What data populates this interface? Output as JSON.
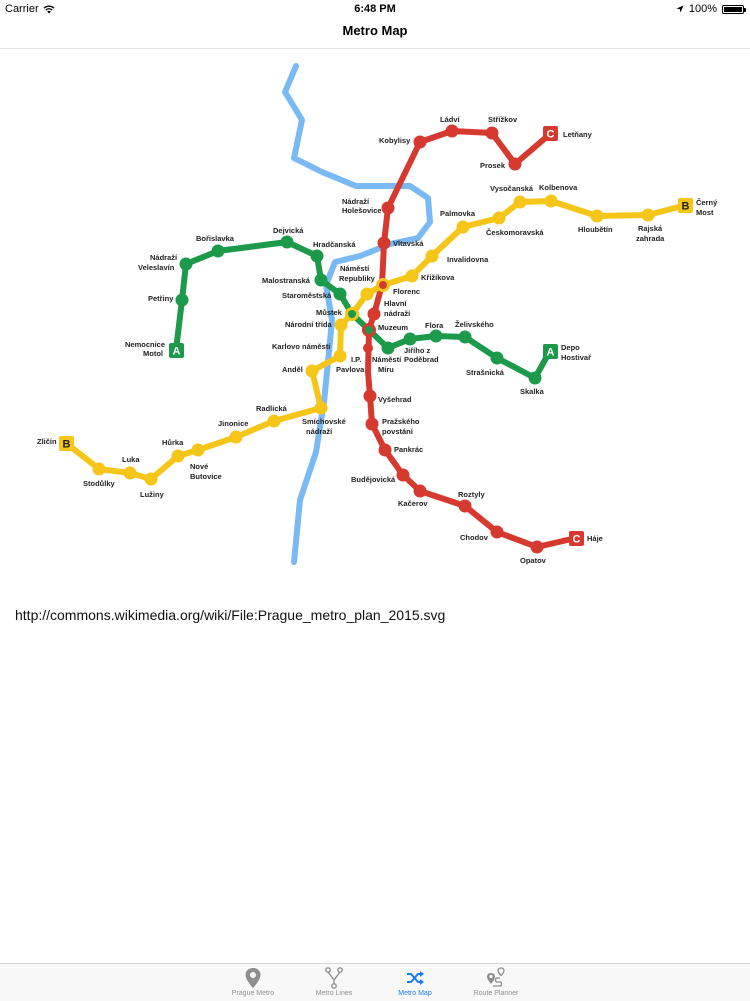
{
  "status_bar": {
    "carrier": "Carrier",
    "time": "6:48 PM",
    "battery": "100%",
    "battery_level": 1.0
  },
  "nav": {
    "title": "Metro Map"
  },
  "source_link": "http://commons.wikimedia.org/wiki/File:Prague_metro_plan_2015.svg",
  "colors": {
    "line_a": "#1c9a4a",
    "line_b": "#f5c518",
    "line_c": "#d63a2f",
    "river": "#79b9f4",
    "tab_active": "#1b7cf2",
    "tab_inactive": "#8e8e8e"
  },
  "map": {
    "line_letters": {
      "a1": "A",
      "a2": "A",
      "b1": "B",
      "b2": "B",
      "c1": "C",
      "c2": "C"
    },
    "stations": {
      "letnany": "Letňany",
      "prosek": "Prosek",
      "strizkov": "Střížkov",
      "ladvi": "Ládví",
      "kobylisy": "Kobylisy",
      "nadrazi_holesovice_1": "Nádraží",
      "nadrazi_holesovice_2": "Holešovice",
      "vltavska": "Vltavská",
      "florenc": "Florenc",
      "hlavni_nadrazi_1": "Hlavní",
      "hlavni_nadrazi_2": "nádraží",
      "muzeum": "Muzeum",
      "ip_pavlova_1": "I.P.",
      "ip_pavlova_2": "Pavlova",
      "namesti_miru_1": "Náměstí",
      "namesti_miru_2": "Míru",
      "vysehrad": "Vyšehrad",
      "prazskeho_povstani_1": "Pražského",
      "prazskeho_povstani_2": "povstání",
      "pankrac": "Pankrác",
      "budejovicka": "Budějovická",
      "kacerov": "Kačerov",
      "roztyly": "Roztyly",
      "chodov": "Chodov",
      "opatov": "Opatov",
      "haje": "Háje",
      "nemocnice_motol_1": "Nemocnice",
      "nemocnice_motol_2": "Motol",
      "petriny": "Petřiny",
      "nadrazi_veleslavin_1": "Nádraží",
      "nadrazi_veleslavin_2": "Veleslavín",
      "borislavka": "Bořislavka",
      "dejvicka": "Dejvická",
      "hradcanska": "Hradčanská",
      "malostranska": "Malostranská",
      "staromestska": "Staroměstská",
      "mustek": "Můstek",
      "jiriho_1": "Jiřího z",
      "jiriho_2": "Poděbrad",
      "flora": "Flora",
      "zelivskeho": "Želivského",
      "strasnicka": "Strašnická",
      "skalka": "Skalka",
      "depo_1": "Depo",
      "depo_2": "Hostivař",
      "zlicin": "Zličín",
      "stodulky": "Stodůlky",
      "luka": "Luka",
      "luziny": "Lužiny",
      "hurka": "Hůrka",
      "nove_butovice_1": "Nové",
      "nove_butovice_2": "Butovice",
      "jinonice": "Jinonice",
      "radlicka": "Radlická",
      "smichovske_1": "Smíchovské",
      "smichovske_2": "nádraží",
      "andel": "Anděl",
      "karlovo": "Karlovo náměstí",
      "narodni": "Národní třída",
      "namesti_republiky_1": "Náměstí",
      "namesti_republiky_2": "Republiky",
      "krizikova": "Křižíkova",
      "invalidovna": "Invalidovna",
      "palmovka": "Palmovka",
      "ceskomoravska": "Českomoravská",
      "vysocanska": "Vysočanská",
      "kolbenova": "Kolbenova",
      "hloubetin": "Hloubětín",
      "rajska_1": "Rajská",
      "rajska_2": "zahrada",
      "cerny_1": "Černý",
      "cerny_2": "Most"
    }
  },
  "tabs": [
    {
      "label": "Prague Metro",
      "icon": "map-pin-icon",
      "active": false
    },
    {
      "label": "Metro Lines",
      "icon": "branch-lines-icon",
      "active": false
    },
    {
      "label": "Metro Map",
      "icon": "shuffle-icon",
      "active": true
    },
    {
      "label": "Route Planner",
      "icon": "route-planner-icon",
      "active": false
    }
  ]
}
